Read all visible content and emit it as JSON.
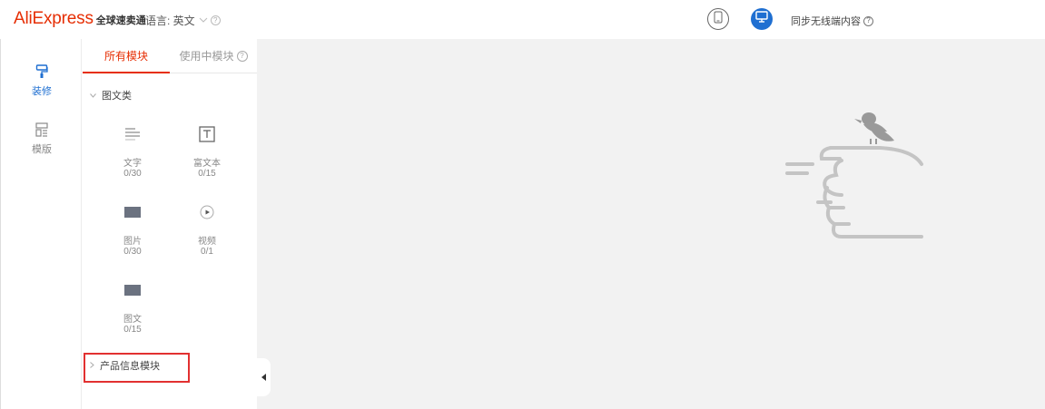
{
  "header": {
    "logo_main": "AliExpress",
    "logo_sub": "全球速卖通",
    "language_label": "语言: 英文",
    "language_chevron_icon": "chevron-down-icon",
    "mobile_view_icon": "mobile-device-icon",
    "pc_view_icon": "desktop-monitor-icon",
    "sync_label": "同步无线端内容",
    "help_icon": "question-circle-icon"
  },
  "rail": {
    "items": [
      {
        "label": "装修",
        "icon": "paint-roller-icon",
        "active": true
      },
      {
        "label": "模版",
        "icon": "template-layout-icon",
        "active": false
      }
    ]
  },
  "panel": {
    "tabs": [
      {
        "label": "所有模块",
        "active": true
      },
      {
        "label": "使用中模块",
        "active": false
      }
    ],
    "groups": [
      {
        "label": "图文类",
        "expanded": true,
        "modules": [
          {
            "name": "文字",
            "count": "0/30",
            "icon": "text-lines-icon"
          },
          {
            "name": "富文本",
            "count": "0/15",
            "icon": "rich-text-icon"
          },
          {
            "name": "图片",
            "count": "0/30",
            "icon": "image-block-icon"
          },
          {
            "name": "视频",
            "count": "0/1",
            "icon": "video-play-icon"
          },
          {
            "name": "图文",
            "count": "0/15",
            "icon": "image-text-icon"
          }
        ]
      },
      {
        "label": "产品信息模块",
        "expanded": false
      }
    ]
  },
  "canvas": {
    "empty_illustration": "bird-on-hand-illustration"
  },
  "colors": {
    "brand_red": "#e62e04",
    "accent_blue": "#1f6fd1",
    "highlight_red": "#e23030",
    "canvas_bg": "#f2f2f2"
  }
}
